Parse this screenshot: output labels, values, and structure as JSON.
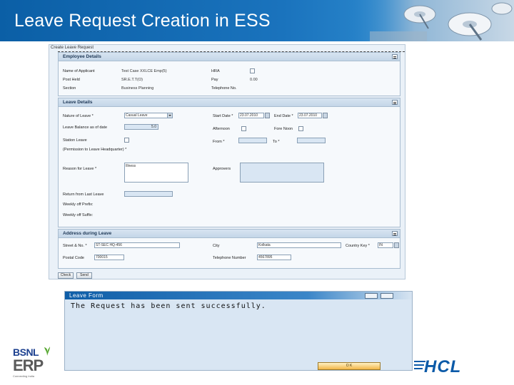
{
  "slide": {
    "title": "Leave Request Creation in ESS"
  },
  "form": {
    "window_title": "Create Leave Request",
    "employee_details": {
      "heading": "Employee Details",
      "name_label": "Name of Applicant",
      "name_value": "Test Case XXLCE Emp(5)",
      "post_held_label": "Post Held",
      "post_held_value": "SR.E.T.T(O)",
      "section_label": "Section",
      "section_value": "Business Planning",
      "hra_label": "HRA",
      "pay_label": "Pay",
      "pay_value": "0.00",
      "telephone_label": "Telephone No."
    },
    "leave_details": {
      "heading": "Leave Details",
      "nature_label": "Nature of Leave *",
      "nature_value": "Casual Leave",
      "balance_label": "Leave Balance as of date",
      "balance_value": "5.0",
      "station_leave_label": "Station Leave",
      "permission_label": "(Permission to Leave Headquarter) *",
      "reason_label": "Reason for Leave *",
      "reason_value": "Illness",
      "return_label": "Return from Last Leave",
      "weekoff_prefix_label": "Weekly off Prefix:",
      "weekoff_suffix_label": "Weekly off Suffix:",
      "start_date_label": "Start Date *",
      "start_date_value": "23.07.2010",
      "end_date_label": "End Date *",
      "end_date_value": "23.07.2010",
      "afternoon_label": "Afternoon",
      "forenoon_label": "Fore Noon",
      "from_label": "From *",
      "to_label": "To *",
      "approvers_label": "Approvers"
    },
    "address": {
      "heading": "Address during Leave",
      "street_label": "Street & No. *",
      "street_value": "ST-SEC HQ-456",
      "city_label": "City",
      "city_value": "Kolkata",
      "country_label": "Country Key *",
      "country_value": "IN",
      "postal_label": "Postal Code",
      "postal_value": "700015",
      "telephone_label": "Telephone Number",
      "telephone_value": "4567895"
    },
    "buttons": {
      "check": "Check",
      "send": "Send"
    }
  },
  "confirmation": {
    "title": "Leave Form",
    "message": "The Request has been sent successfully.",
    "ok_label": "O K"
  },
  "logos": {
    "bsnl_label": "BSNL",
    "erp_label": "ERP",
    "bsnl_tagline": "Connecting India",
    "hcl_label": "HCL"
  },
  "colors": {
    "banner": "#1a73bd",
    "section_header": "#c4d6e8",
    "form_bg": "#eaf1f8",
    "hcl_blue": "#0b5aa8",
    "bsnl_blue": "#1b3f8f",
    "ok_button": "#f2b646"
  },
  "icons": [
    "satellite-dish-icon",
    "dropdown-arrow-icon",
    "calendar-icon",
    "collapse-icon",
    "leaf-icon",
    "window-minimize-icon",
    "window-close-icon"
  ]
}
